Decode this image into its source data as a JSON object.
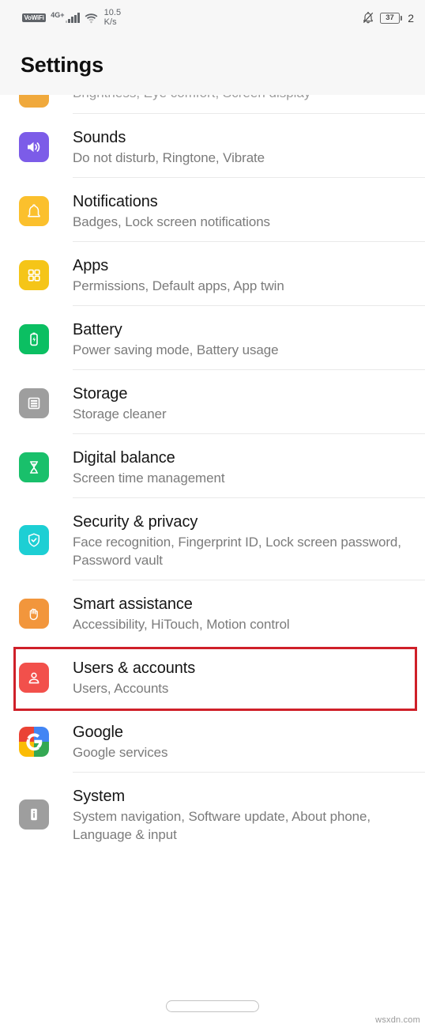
{
  "status_bar": {
    "vowifi_label": "VoWiFi",
    "network_label": "4G+",
    "signal_icon": "signal-bars-icon",
    "wifi_icon": "wifi-icon",
    "data_rate_value": "10.5",
    "data_rate_unit": "K/s",
    "silent_icon": "bell-off-icon",
    "battery_icon": "battery-icon",
    "battery_percent": "37",
    "clock": "2"
  },
  "header": {
    "title": "Settings"
  },
  "colors": {
    "accent_highlight": "#cf2029",
    "sounds": "#7C5CE8",
    "notifications": "#FBC02D",
    "apps": "#F5C518",
    "battery": "#0BBF62",
    "storage": "#9E9E9E",
    "digital_balance": "#19C06B",
    "security": "#1DCFD4",
    "smart_assistance": "#F2963C",
    "users_accounts": "#F2504B",
    "system": "#9E9E9E",
    "title_text": "#151515",
    "subtitle_text": "#7b7b7b",
    "divider": "#e9e9e9"
  },
  "partial_row": {
    "subtitle": "Brightness, Eye comfort, Screen display",
    "icon": "display-icon"
  },
  "list": {
    "items": [
      {
        "title": "Sounds",
        "subtitle": "Do not disturb, Ringtone, Vibrate",
        "icon": "speaker-volume-icon",
        "name": "sounds",
        "color_key": "sounds",
        "highlighted": false
      },
      {
        "title": "Notifications",
        "subtitle": "Badges, Lock screen notifications",
        "icon": "bell-icon",
        "name": "notifications",
        "color_key": "notifications",
        "highlighted": false
      },
      {
        "title": "Apps",
        "subtitle": "Permissions, Default apps, App twin",
        "icon": "app-grid-icon",
        "name": "apps",
        "color_key": "apps",
        "highlighted": false
      },
      {
        "title": "Battery",
        "subtitle": "Power saving mode, Battery usage",
        "icon": "battery-bolt-icon",
        "name": "battery",
        "color_key": "battery",
        "highlighted": false
      },
      {
        "title": "Storage",
        "subtitle": "Storage cleaner",
        "icon": "storage-lines-icon",
        "name": "storage",
        "color_key": "storage",
        "highlighted": false
      },
      {
        "title": "Digital balance",
        "subtitle": "Screen time management",
        "icon": "hourglass-icon",
        "name": "digital-balance",
        "color_key": "digital_balance",
        "highlighted": false
      },
      {
        "title": "Security & privacy",
        "subtitle": "Face recognition, Fingerprint ID, Lock screen password, Password vault",
        "icon": "shield-check-icon",
        "name": "security-privacy",
        "color_key": "security",
        "highlighted": false
      },
      {
        "title": "Smart assistance",
        "subtitle": "Accessibility, HiTouch, Motion control",
        "icon": "hand-icon",
        "name": "smart-assistance",
        "color_key": "smart_assistance",
        "highlighted": false
      },
      {
        "title": "Users & accounts",
        "subtitle": "Users, Accounts",
        "icon": "user-person-icon",
        "name": "users-accounts",
        "color_key": "users_accounts",
        "highlighted": true
      },
      {
        "title": "Google",
        "subtitle": "Google services",
        "icon": "google-g-icon",
        "name": "google",
        "color_key": "",
        "highlighted": false
      },
      {
        "title": "System",
        "subtitle": "System navigation, Software update, About phone, Language & input",
        "icon": "phone-info-icon",
        "name": "system",
        "color_key": "system",
        "highlighted": false
      }
    ]
  },
  "navbar": {
    "home_pill": "home-gesture-pill"
  },
  "watermark": "wsxdn.com"
}
